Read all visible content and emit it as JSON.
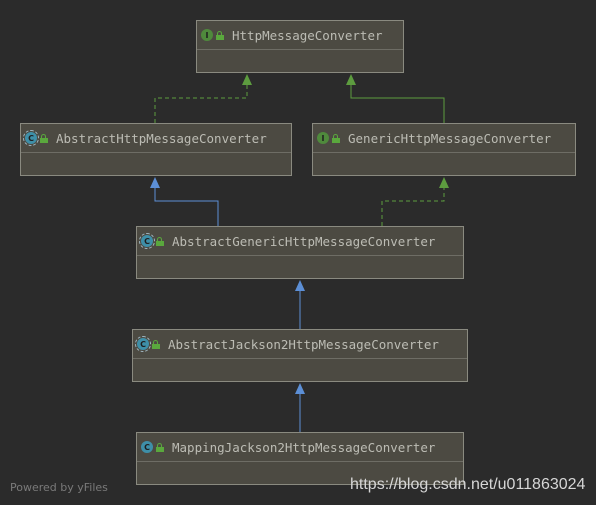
{
  "diagram": {
    "nodes": [
      {
        "id": "n1",
        "name": "HttpMessageConverter",
        "kind": "interface",
        "badge": "I"
      },
      {
        "id": "n2",
        "name": "AbstractHttpMessageConverter",
        "kind": "abstract-class",
        "badge": "C"
      },
      {
        "id": "n3",
        "name": "GenericHttpMessageConverter",
        "kind": "interface",
        "badge": "I"
      },
      {
        "id": "n4",
        "name": "AbstractGenericHttpMessageConverter",
        "kind": "abstract-class",
        "badge": "C"
      },
      {
        "id": "n5",
        "name": "AbstractJackson2HttpMessageConverter",
        "kind": "abstract-class",
        "badge": "C"
      },
      {
        "id": "n6",
        "name": "MappingJackson2HttpMessageConverter",
        "kind": "class",
        "badge": "C"
      }
    ],
    "edges": [
      {
        "from": "n2",
        "to": "n1",
        "type": "implements"
      },
      {
        "from": "n3",
        "to": "n1",
        "type": "extends-interface"
      },
      {
        "from": "n4",
        "to": "n2",
        "type": "extends"
      },
      {
        "from": "n4",
        "to": "n3",
        "type": "implements"
      },
      {
        "from": "n5",
        "to": "n4",
        "type": "extends"
      },
      {
        "from": "n6",
        "to": "n5",
        "type": "extends"
      }
    ],
    "colors": {
      "background": "#2b2b2b",
      "extends": "#5c8fd6",
      "implements": "#5d9c3f",
      "extends-interface": "#5d9c3f"
    }
  },
  "footer": {
    "powered_by": "Powered by yFiles",
    "watermark": "https://blog.csdn.net/u011863024"
  }
}
